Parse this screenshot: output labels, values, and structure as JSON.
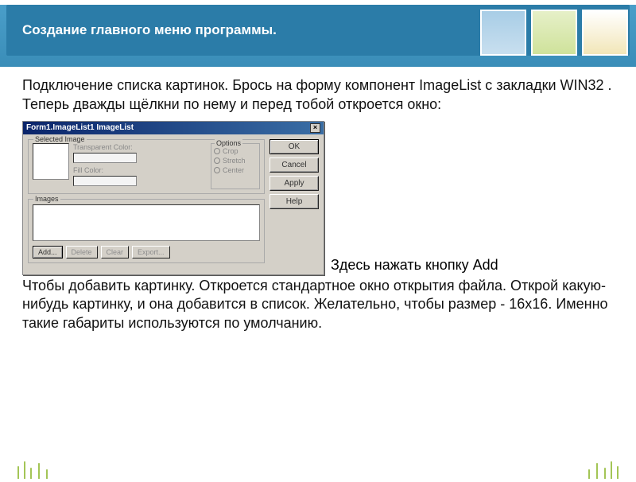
{
  "header": {
    "title": "Создание главного меню программы."
  },
  "paragraph1": "Подключение списка картинок. Брось на форму компонент ImageList с закладки WIN32 . Теперь дважды щёлкни по нему и перед тобой откроется окно:",
  "dialog": {
    "title": "Form1.ImageList1 ImageList",
    "groups": {
      "selected": "Selected Image",
      "options": "Options",
      "images": "Images"
    },
    "labels": {
      "transparent": "Transparent Color:",
      "fill": "Fill Color:"
    },
    "options": {
      "crop": "Crop",
      "stretch": "Stretch",
      "center": "Center"
    },
    "buttons": {
      "ok": "OK",
      "cancel": "Cancel",
      "apply": "Apply",
      "help": "Help",
      "add": "Add...",
      "delete": "Delete",
      "clear": "Clear",
      "export": "Export..."
    }
  },
  "paragraph2_inline": "Здесь нажать кнопку Add",
  "paragraph3": "Чтобы добавить картинку. Откроется стандартное окно открытия файла. Открой какую-нибудь картинку, и она добавится в список. Желательно, чтобы размер - 16х16. Именно такие габариты используются по  умолчанию."
}
